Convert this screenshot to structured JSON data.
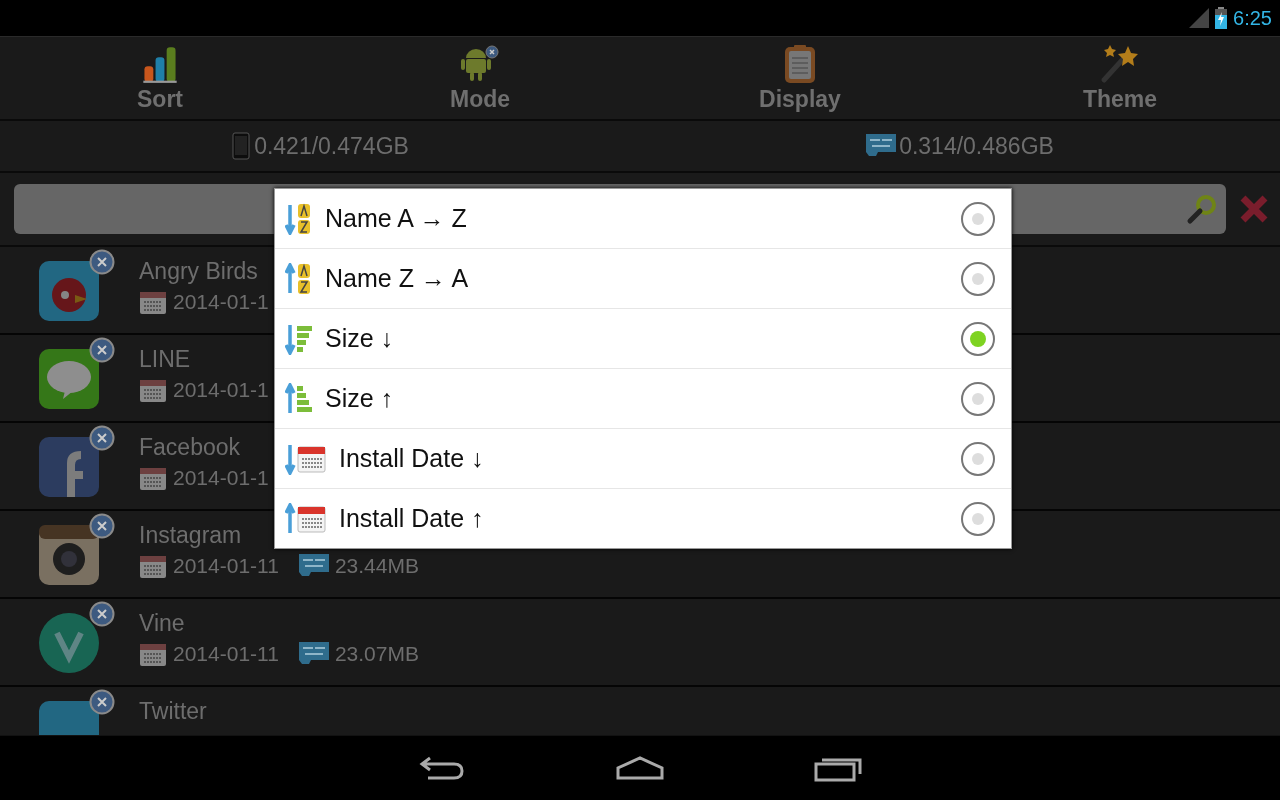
{
  "status_bar": {
    "time": "6:25"
  },
  "toolbar": [
    {
      "kind": "sort",
      "label": "Sort"
    },
    {
      "kind": "mode",
      "label": "Mode"
    },
    {
      "kind": "display",
      "label": "Display"
    },
    {
      "kind": "theme",
      "label": "Theme"
    }
  ],
  "storage": [
    {
      "kind": "phone",
      "value": "0.421/0.474GB"
    },
    {
      "kind": "sd",
      "value": "0.314/0.486GB"
    }
  ],
  "apps": [
    {
      "name": "Angry Birds",
      "date": "2014-01-1"
    },
    {
      "name": "LINE",
      "date": "2014-01-1"
    },
    {
      "name": "Facebook",
      "date": "2014-01-1"
    },
    {
      "name": "Instagram",
      "date": "2014-01-11",
      "size": "23.44MB"
    },
    {
      "name": "Vine",
      "date": "2014-01-11",
      "size": "23.07MB"
    },
    {
      "name": "Twitter"
    }
  ],
  "sort_dialog": {
    "options": [
      {
        "kind": "name-asc",
        "label": "Name A → Z",
        "selected": false
      },
      {
        "kind": "name-desc",
        "label": "Name Z → A",
        "selected": false
      },
      {
        "kind": "size-desc",
        "label": "Size ↓",
        "selected": true
      },
      {
        "kind": "size-asc",
        "label": "Size ↑",
        "selected": false
      },
      {
        "kind": "date-desc",
        "label": "Install Date ↓",
        "selected": false
      },
      {
        "kind": "date-asc",
        "label": "Install Date ↑",
        "selected": false
      }
    ]
  }
}
